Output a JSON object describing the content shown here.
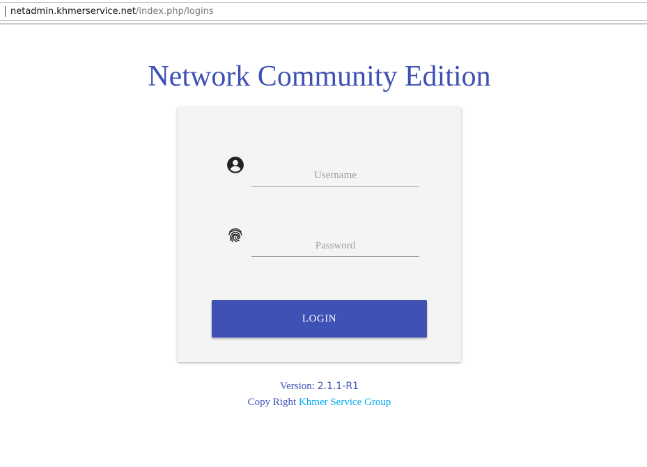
{
  "browser": {
    "url_host": "netadmin.khmerservice.net",
    "url_path": "/index.php/logins"
  },
  "page": {
    "title": "Network Community Edition"
  },
  "login_form": {
    "username_placeholder": "Username",
    "password_placeholder": "Password",
    "username_value": "",
    "password_value": "",
    "login_button_label": "LOGIN",
    "username_icon": "account-circle-icon",
    "password_icon": "fingerprint-icon"
  },
  "footer": {
    "version_label": "Version:",
    "version_number": "2.1.1-R1",
    "copyright_label": "Copy Right",
    "company_link": "Khmer Service Group"
  },
  "colors": {
    "primary": "#3f51b5",
    "link": "#03a9f4",
    "card_bg": "#f4f4f4"
  }
}
